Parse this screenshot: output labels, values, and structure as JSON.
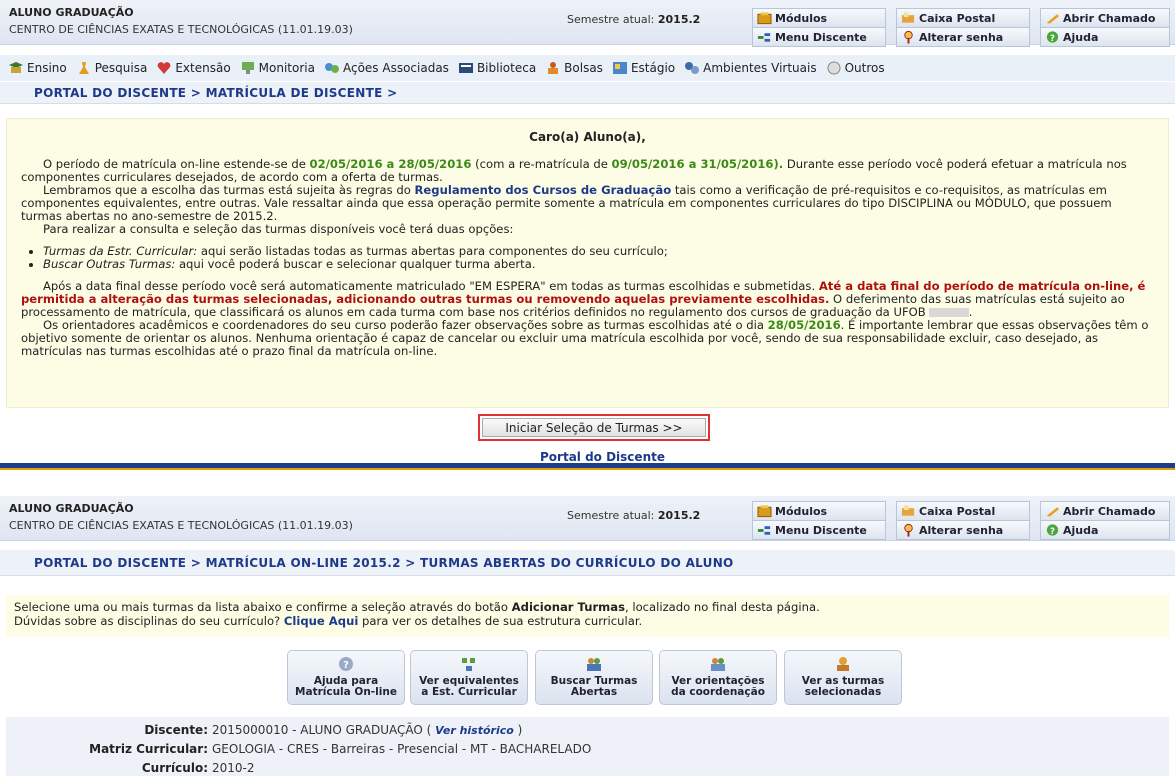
{
  "header": {
    "user_name": "ALUNO GRADUAÇÃO",
    "center": "CENTRO DE CIÊNCIAS EXATAS E TECNOLÓGICAS (11.01.19.03)",
    "semester_label": "Semestre atual:",
    "semester_value": "2015.2",
    "buttons": {
      "modulos": "Módulos",
      "caixa_postal": "Caixa Postal",
      "abrir_chamado": "Abrir Chamado",
      "menu_discente": "Menu Discente",
      "alterar_senha": "Alterar senha",
      "ajuda": "Ajuda"
    }
  },
  "menu": [
    "Ensino",
    "Pesquisa",
    "Extensão",
    "Monitoria",
    "Ações Associadas",
    "Biblioteca",
    "Bolsas",
    "Estágio",
    "Ambientes Virtuais",
    "Outros"
  ],
  "breadcrumb1": "PORTAL DO DISCENTE > MATRÍCULA DE DISCENTE >",
  "notice": {
    "title": "Caro(a) Aluno(a),",
    "p1_a": "O período de matrícula on-line estende-se de ",
    "p1_dates": "02/05/2016 a 28/05/2016",
    "p1_b": " (com a re-matrícula de ",
    "p1_redates": "09/05/2016 a 31/05/2016).",
    "p1_c": " Durante esse período você poderá efetuar a matrícula nos componentes curriculares desejados, de acordo com a oferta de turmas.",
    "p2_a": "Lembramos que a escolha das turmas está sujeita às regras do ",
    "p2_link": "Regulamento dos Cursos de Graduação",
    "p2_b": " tais como a verificação de pré-requisitos e co-requisitos, as matrículas em componentes equivalentes, entre outras. Vale ressaltar ainda que essa operação permite somente a matrícula em componentes curriculares do tipo DISCIPLINA ou MÓDULO, que possuem turmas abertas no ano-semestre de 2015.2.",
    "p3": "Para realizar a consulta e seleção das turmas disponíveis você terá duas opções:",
    "li1_em": "Turmas da Estr. Curricular:",
    "li1": " aqui serão listadas todas as turmas abertas para componentes do seu currículo;",
    "li2_em": "Buscar Outras Turmas:",
    "li2": " aqui você poderá buscar e selecionar qualquer turma aberta.",
    "p4_a": "Após a data final desse período você será automaticamente matriculado \"EM ESPERA\" em todas as turmas escolhidas e submetidas. ",
    "p4_red": "Até a data final do período de matrícula on-line, é permitida a alteração das turmas selecionadas, adicionando outras turmas ou removendo aquelas previamente escolhidas.",
    "p4_b": " O deferimento das suas matrículas está sujeito ao processamento de matrícula, que classificará os alunos em cada turma com base nos critérios definidos no regulamento dos cursos de graduação da UFOB",
    "p4_c": ".",
    "p5_a": "Os orientadores acadêmicos e coordenadores do seu curso poderão fazer observações sobre as turmas escolhidas até o dia ",
    "p5_date": "28/05/2016",
    "p5_b": ". É importante lembrar que essas observações têm o objetivo somente de orientar os alunos. Nenhuma orientação é capaz de cancelar ou excluir uma matrícula escolhida por você, sendo de sua responsabilidade excluir, caso desejado, as matrículas nas turmas escolhidas até o prazo final da matrícula on-line."
  },
  "start_button": "Iniciar Seleção de Turmas >>",
  "portal_link": "Portal do Discente",
  "breadcrumb2": "PORTAL DO DISCENTE > MATRÍCULA ON-LINE 2015.2 > TURMAS ABERTAS DO CURRÍCULO DO ALUNO",
  "notice2": {
    "a": "Selecione uma ou mais turmas da lista abaixo e confirme a seleção através do botão ",
    "b": "Adicionar Turmas",
    "c": ", localizado no final desta página.",
    "d": "Dúvidas sobre as disciplinas do seu currículo? ",
    "e": "Clique Aqui",
    "f": " para ver os detalhes de sua estrutura curricular."
  },
  "actions": [
    {
      "l1": "Ajuda para",
      "l2": "Matrícula On-line"
    },
    {
      "l1": "Ver equivalentes",
      "l2": "a Est. Curricular"
    },
    {
      "l1": "Buscar Turmas",
      "l2": "Abertas"
    },
    {
      "l1": "Ver orientações",
      "l2": "da coordenação"
    },
    {
      "l1": "Ver as turmas",
      "l2": "selecionadas"
    }
  ],
  "info": {
    "discente_label": "Discente:",
    "discente_value": "2015000010 - ALUNO GRADUAÇÃO (",
    "historico": "Ver histórico",
    "discente_close": ")",
    "matriz_label": "Matriz Curricular:",
    "matriz_value": "GEOLOGIA - CRES - Barreiras - Presencial - MT - BACHARELADO",
    "curriculo_label": "Currículo:",
    "curriculo_value": "2010-2"
  }
}
